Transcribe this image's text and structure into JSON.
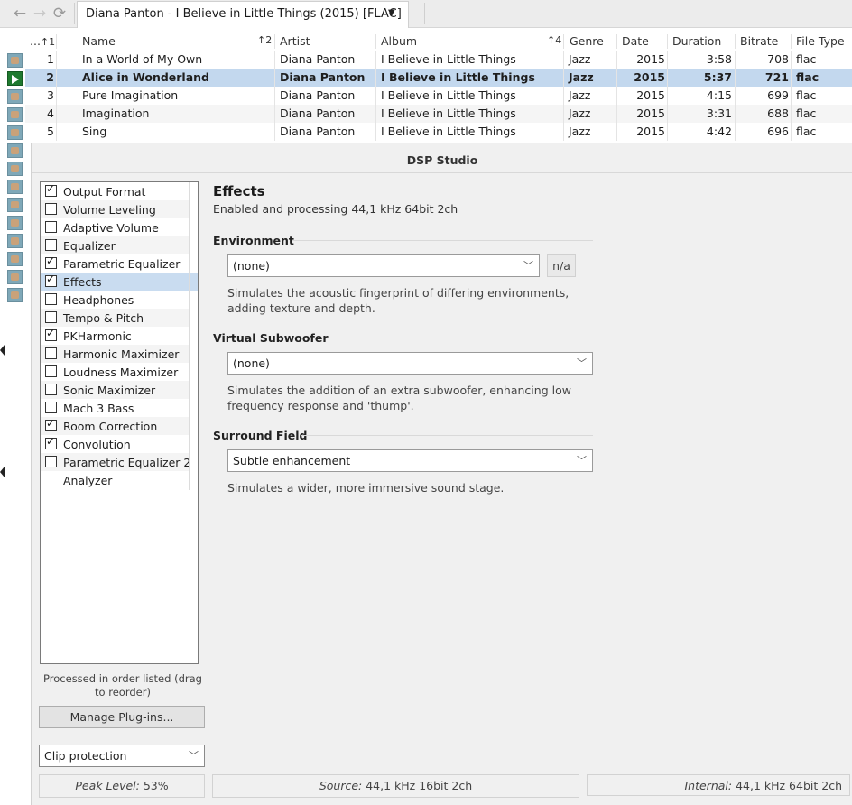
{
  "topbar": {
    "back_icon": "arrow-left-icon",
    "forward_icon": "arrow-right-icon",
    "refresh_icon": "refresh-icon",
    "tab_title": "Diana Panton - I Believe in Little Things (2015) [FLAC]"
  },
  "list": {
    "headers": {
      "num": "...",
      "num_sort": "↑1",
      "name": "Name",
      "artist_sort": "↑2",
      "artist": "Artist",
      "album": "Album",
      "genre_sort": "↑4",
      "genre": "Genre",
      "date": "Date",
      "duration": "Duration",
      "bitrate": "Bitrate",
      "filetype": "File Type"
    },
    "rows": [
      {
        "num": "1",
        "name": "In a World of My Own",
        "artist": "Diana Panton",
        "album": "I Believe in Little Things",
        "genre": "Jazz",
        "date": "2015",
        "duration": "3:58",
        "bitrate": "708",
        "filetype": "flac"
      },
      {
        "num": "2",
        "name": "Alice in Wonderland",
        "artist": "Diana Panton",
        "album": "I Believe in Little Things",
        "genre": "Jazz",
        "date": "2015",
        "duration": "5:37",
        "bitrate": "721",
        "filetype": "flac"
      },
      {
        "num": "3",
        "name": "Pure Imagination",
        "artist": "Diana Panton",
        "album": "I Believe in Little Things",
        "genre": "Jazz",
        "date": "2015",
        "duration": "4:15",
        "bitrate": "699",
        "filetype": "flac"
      },
      {
        "num": "4",
        "name": "Imagination",
        "artist": "Diana Panton",
        "album": "I Believe in Little Things",
        "genre": "Jazz",
        "date": "2015",
        "duration": "3:31",
        "bitrate": "688",
        "filetype": "flac"
      },
      {
        "num": "5",
        "name": "Sing",
        "artist": "Diana Panton",
        "album": "I Believe in Little Things",
        "genre": "Jazz",
        "date": "2015",
        "duration": "4:42",
        "bitrate": "696",
        "filetype": "flac"
      }
    ]
  },
  "dsp": {
    "title": "DSP Studio",
    "plugins": [
      {
        "label": "Output Format",
        "checked": true
      },
      {
        "label": "Volume Leveling",
        "checked": false
      },
      {
        "label": "Adaptive Volume",
        "checked": false
      },
      {
        "label": "Equalizer",
        "checked": false
      },
      {
        "label": "Parametric Equalizer",
        "checked": true
      },
      {
        "label": "Effects",
        "checked": true
      },
      {
        "label": "Headphones",
        "checked": false
      },
      {
        "label": "Tempo & Pitch",
        "checked": false
      },
      {
        "label": "PKHarmonic",
        "checked": true
      },
      {
        "label": "Harmonic Maximizer",
        "checked": false
      },
      {
        "label": "Loudness Maximizer",
        "checked": false
      },
      {
        "label": "Sonic Maximizer",
        "checked": false
      },
      {
        "label": "Mach 3 Bass",
        "checked": false
      },
      {
        "label": "Room Correction",
        "checked": true
      },
      {
        "label": "Convolution",
        "checked": true
      },
      {
        "label": "Parametric Equalizer 2",
        "checked": false
      },
      {
        "label": "Analyzer",
        "checked": null
      }
    ],
    "order_note": "Processed in order listed (drag to reorder)",
    "manage_label": "Manage Plug-ins...",
    "clip_value": "Clip protection",
    "effects_title": "Effects",
    "effects_sub": "Enabled and processing 44,1 kHz 64bit 2ch",
    "environment": {
      "label": "Environment",
      "value": "(none)",
      "na": "n/a",
      "desc": "Simulates the acoustic fingerprint of differing environments, adding texture and depth."
    },
    "subwoofer": {
      "label": "Virtual Subwoofer",
      "value": "(none)",
      "desc": "Simulates the addition of an extra subwoofer, enhancing low frequency response and 'thump'."
    },
    "surround": {
      "label": "Surround Field",
      "value": "Subtle enhancement",
      "desc": "Simulates a wider, more immersive sound stage."
    },
    "status": {
      "peak_label": "Peak Level:",
      "peak_value": "53%",
      "source_label": "Source:",
      "source_value": "44,1 kHz 16bit 2ch",
      "internal_label": "Internal:",
      "internal_value": "44,1 kHz 64bit 2ch"
    }
  }
}
